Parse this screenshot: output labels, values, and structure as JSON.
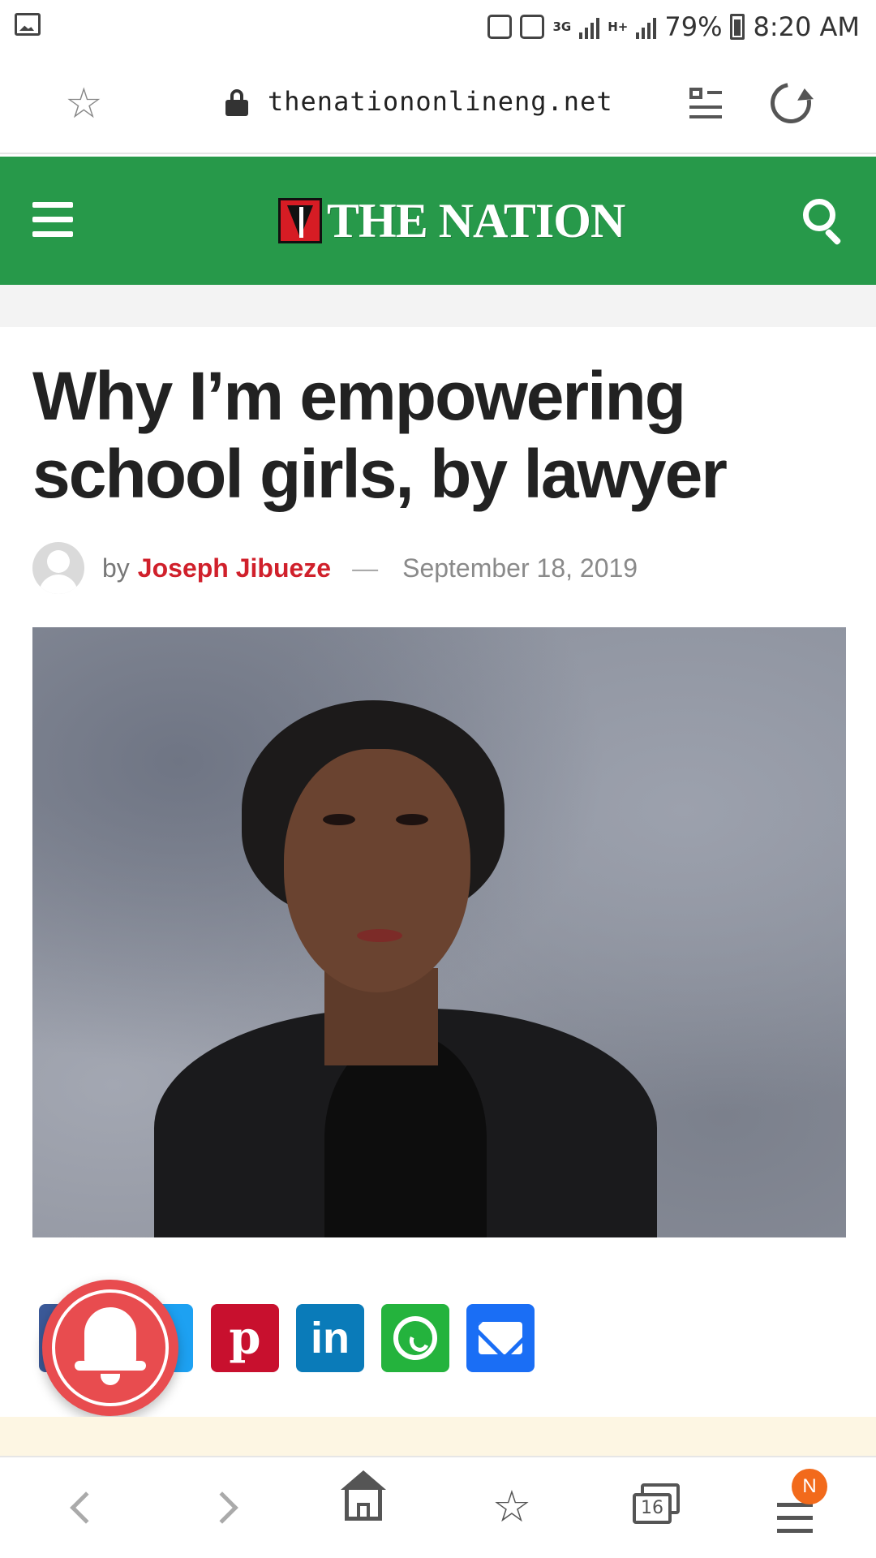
{
  "status_bar": {
    "network_type": "3G",
    "network_type_2": "H+",
    "battery": "79%",
    "time": "8:20 AM"
  },
  "browser": {
    "url": "thenationonlineng.net",
    "tab_count": "16",
    "menu_badge": "N"
  },
  "site": {
    "logo_text": "THE NATION",
    "brand_color": "#27994a"
  },
  "article": {
    "title": "Why I’m empowering school girls, by lawyer",
    "by_label": "by",
    "author": "Joseph Jibueze",
    "separator": "—",
    "date": "September 18, 2019"
  },
  "share": {
    "pinterest_glyph": "p",
    "linkedin_glyph": "in",
    "networks": [
      "facebook",
      "twitter",
      "pinterest",
      "linkedin",
      "whatsapp",
      "email"
    ]
  },
  "icons": {
    "bookmark": "star-icon",
    "lock": "lock-icon",
    "reader": "reader-mode-icon",
    "reload": "reload-icon",
    "menu": "hamburger-icon",
    "search": "search-icon",
    "notification": "bell-icon"
  }
}
